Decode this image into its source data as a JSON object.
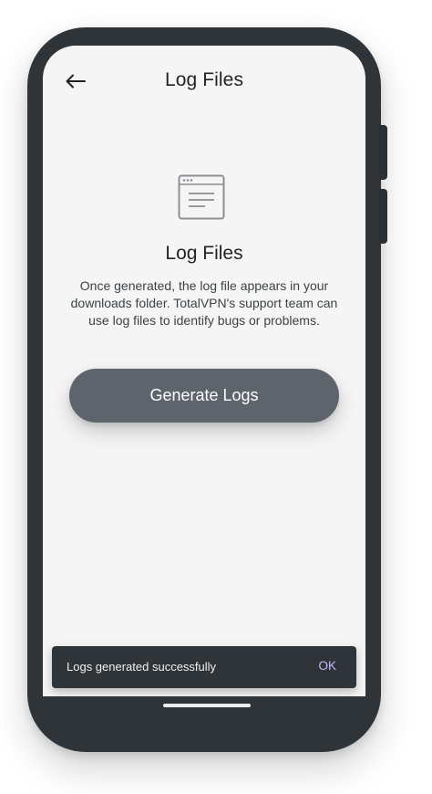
{
  "app_bar": {
    "title": "Log Files",
    "back_icon": "arrow-left-icon"
  },
  "content": {
    "icon": "window-file-icon",
    "heading": "Log Files",
    "description": "Once generated, the log file appears in your downloads folder. TotalVPN's support team can use log files to identify bugs or problems.",
    "generate_label": "Generate Logs"
  },
  "snackbar": {
    "message": "Logs generated successfully",
    "action": "OK"
  },
  "colors": {
    "button": "#5e646c",
    "snackbar_bg": "#2f3438",
    "snackbar_action": "#c9b8ff",
    "screen_bg": "#f5f5f5",
    "phone_frame": "#2f3438"
  }
}
